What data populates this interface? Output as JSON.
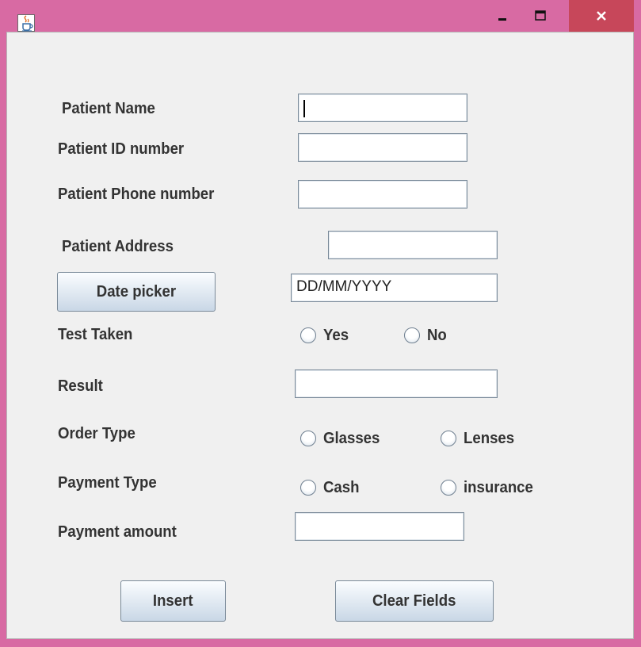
{
  "window": {
    "title": "",
    "accent": "#d86aa3",
    "close_color": "#c7475a"
  },
  "form": {
    "patient_name": {
      "label": "Patient Name",
      "value": ""
    },
    "patient_id": {
      "label": "Patient ID number",
      "value": ""
    },
    "patient_phone": {
      "label": "Patient Phone number",
      "value": ""
    },
    "patient_address": {
      "label": "Patient Address",
      "value": ""
    },
    "date": {
      "button_label": "Date picker",
      "value": "DD/MM/YYYY"
    },
    "test_taken": {
      "label": "Test Taken",
      "options": [
        "Yes",
        "No"
      ]
    },
    "result": {
      "label": "Result",
      "value": ""
    },
    "order_type": {
      "label": "Order Type",
      "options": [
        "Glasses",
        "Lenses"
      ]
    },
    "payment_type": {
      "label": "Payment Type",
      "options": [
        "Cash",
        "insurance"
      ]
    },
    "payment_amount": {
      "label": "Payment amount",
      "value": ""
    }
  },
  "actions": {
    "insert_label": "Insert",
    "clear_label": "Clear Fields"
  },
  "icons": {
    "app": "java-cup-icon",
    "minimize": "minimize-icon",
    "maximize": "maximize-icon",
    "close": "close-icon"
  }
}
